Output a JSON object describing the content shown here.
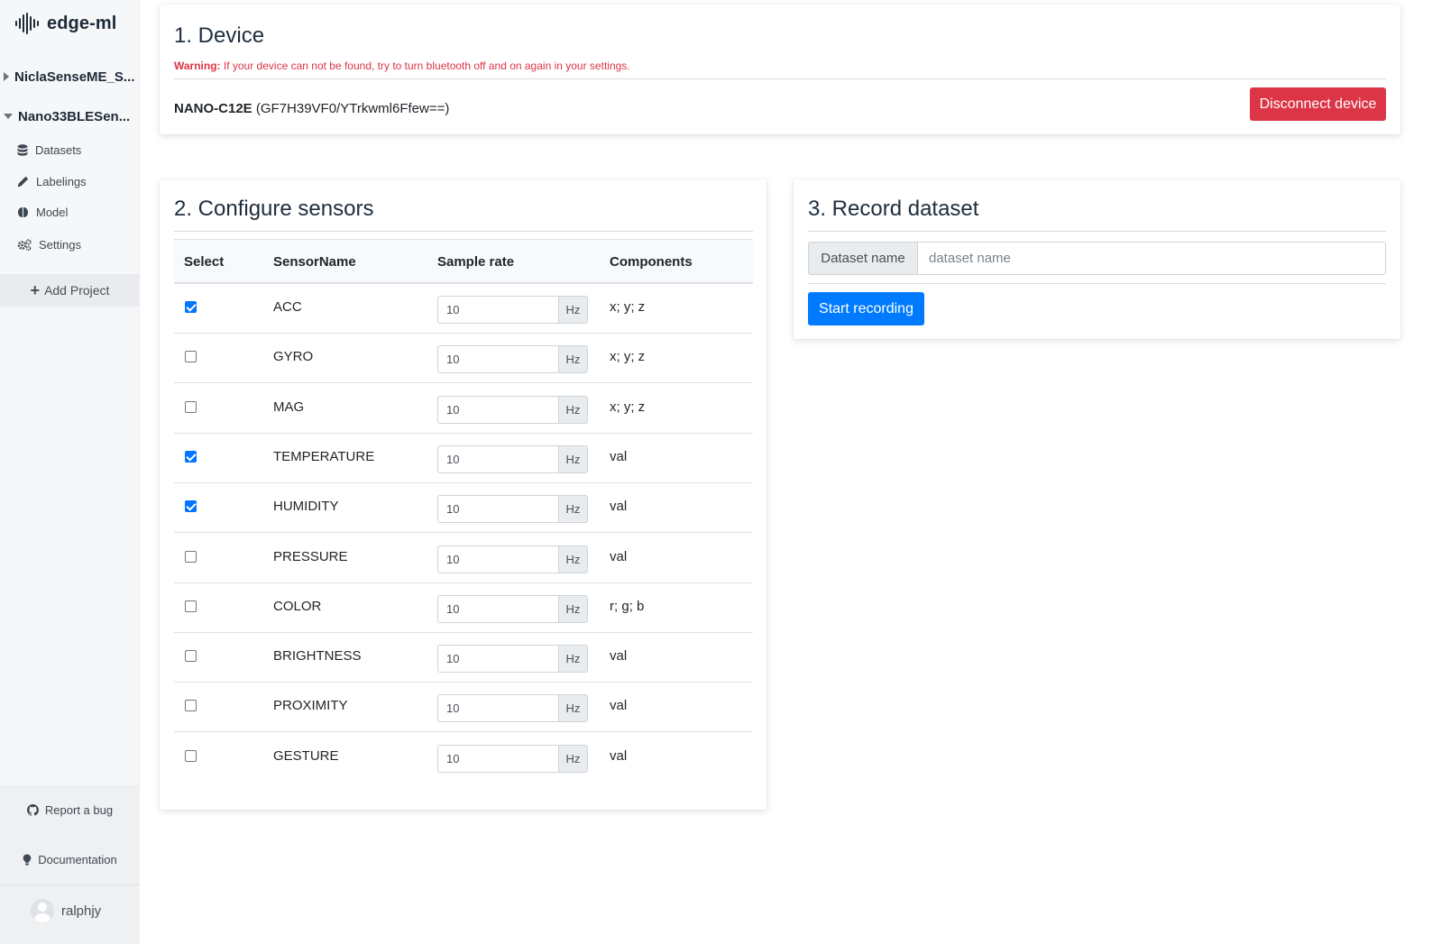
{
  "brand": {
    "name": "edge-ml",
    "logo_icon": "waveform-icon"
  },
  "sidebar": {
    "projects": [
      {
        "name": "NiclaSenseME_S...",
        "expanded": false
      },
      {
        "name": "Nano33BLESen...",
        "expanded": true
      }
    ],
    "nav": [
      {
        "label": "Datasets",
        "icon": "database-icon"
      },
      {
        "label": "Labelings",
        "icon": "pencil-icon"
      },
      {
        "label": "Model",
        "icon": "brain-icon"
      },
      {
        "label": "Settings",
        "icon": "gears-icon"
      }
    ],
    "add_project": "Add Project",
    "footer": {
      "report_bug": "Report a bug",
      "documentation": "Documentation",
      "username": "ralphjy"
    }
  },
  "device": {
    "title": "1. Device",
    "warning_label": "Warning:",
    "warning_text": " If your device can not be found, try to turn bluetooth off and on again in your settings.",
    "device_name": "NANO-C12E",
    "device_id": " (GF7H39VF0/YTrkwml6Ffew==)",
    "disconnect_label": "Disconnect device",
    "disconnect_color": "#dc3545"
  },
  "sensors": {
    "title": "2. Configure sensors",
    "columns": [
      "Select",
      "SensorName",
      "Sample rate",
      "Components"
    ],
    "unit": "Hz",
    "rows": [
      {
        "name": "ACC",
        "selected": true,
        "rate": "10",
        "components": "x; y; z"
      },
      {
        "name": "GYRO",
        "selected": false,
        "rate": "10",
        "components": "x; y; z"
      },
      {
        "name": "MAG",
        "selected": false,
        "rate": "10",
        "components": "x; y; z"
      },
      {
        "name": "TEMPERATURE",
        "selected": true,
        "rate": "10",
        "components": "val"
      },
      {
        "name": "HUMIDITY",
        "selected": true,
        "rate": "10",
        "components": "val"
      },
      {
        "name": "PRESSURE",
        "selected": false,
        "rate": "10",
        "components": "val"
      },
      {
        "name": "COLOR",
        "selected": false,
        "rate": "10",
        "components": "r; g; b"
      },
      {
        "name": "BRIGHTNESS",
        "selected": false,
        "rate": "10",
        "components": "val"
      },
      {
        "name": "PROXIMITY",
        "selected": false,
        "rate": "10",
        "components": "val"
      },
      {
        "name": "GESTURE",
        "selected": false,
        "rate": "10",
        "components": "val"
      }
    ]
  },
  "record": {
    "title": "3. Record dataset",
    "dataset_label": "Dataset name",
    "dataset_value": "",
    "dataset_placeholder": "dataset name",
    "start_label": "Start recording",
    "start_color": "#007bff"
  }
}
